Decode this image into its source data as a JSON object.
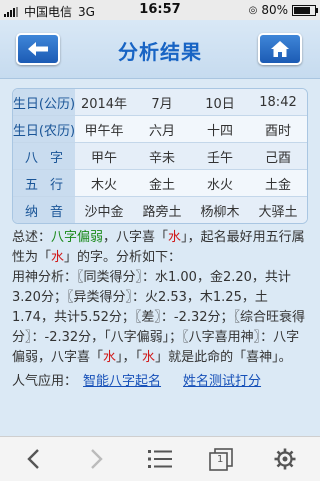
{
  "status": {
    "carrier": "中国电信",
    "network": "3G",
    "time": "16:57",
    "battery": "80%",
    "battery_level": 0.8
  },
  "header": {
    "title": "分析结果",
    "back_icon": "arrow-left-icon",
    "home_icon": "home-icon"
  },
  "table": [
    {
      "label": "生日(公历)",
      "cells": [
        "2014年",
        "7月",
        "10日",
        "18:42"
      ]
    },
    {
      "label": "生日(农历)",
      "cells": [
        "甲午年",
        "六月",
        "十四",
        "酉时"
      ]
    },
    {
      "label_chars": [
        "八",
        "字"
      ],
      "cells": [
        "甲午",
        "辛未",
        "壬午",
        "己酉"
      ]
    },
    {
      "label_chars": [
        "五",
        "行"
      ],
      "cells": [
        "木火",
        "金土",
        "水火",
        "土金"
      ]
    },
    {
      "label_chars": [
        "纳",
        "音"
      ],
      "cells": [
        "沙中金",
        "路旁土",
        "杨柳木",
        "大驿土"
      ]
    }
  ],
  "summary": {
    "prefix": "总述：",
    "bazi": "八字偏弱",
    "mid1": "，八字喜「",
    "xi": "水",
    "mid2": "」，起名最好用五行属性为「",
    "xi2": "水",
    "end": "」的字。分析如下：",
    "detail": "用神分析：〖同类得分〗：水1.00，金2.20，共计3.20分；〖异类得分〗：火2.53，木1.25，土1.74，共计5.52分；〖差〗：-2.32分；〖综合旺衰得分〗：-2.32分，「八字偏弱」；〖八字喜用神〗：八字偏弱，八字喜「",
    "detail_xi": "水",
    "detail_mid": "」，「",
    "detail_xi2": "水",
    "detail_end": "」就是此命的「喜神」。"
  },
  "popular": {
    "label": "人气应用：",
    "link1": "智能八字起名",
    "link2": "姓名测试打分"
  },
  "toolbar": {
    "icons": [
      "back-arrow-icon",
      "forward-arrow-icon",
      "menu-icon",
      "tabs-icon",
      "settings-icon"
    ],
    "tab_count": "1"
  },
  "colors": {
    "accent": "#1864c4",
    "green": "#1a8a1a",
    "red": "#d01818"
  }
}
